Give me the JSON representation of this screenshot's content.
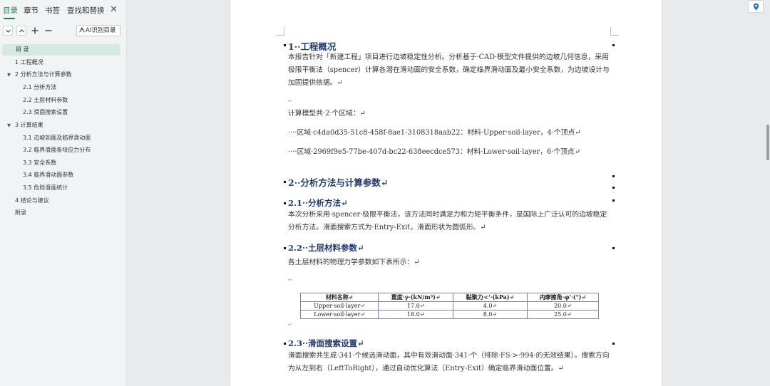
{
  "nav": {
    "tabs": [
      {
        "label": "目录",
        "active": true
      },
      {
        "label": "章节",
        "active": false
      },
      {
        "label": "书签",
        "active": false
      },
      {
        "label": "查找和替换",
        "active": false
      }
    ],
    "close_icon": "close-icon",
    "toolbar": {
      "collapse_icon": "chevron-down-icon",
      "expand_icon": "chevron-up-icon",
      "add_icon": "plus-icon",
      "remove_icon": "minus-icon",
      "ai_label": "AI识别目录",
      "ai_icon": "ai-icon"
    },
    "toc": [
      {
        "label": "目  录",
        "level": 0,
        "selected": true,
        "caret": ""
      },
      {
        "label": "1  工程概况",
        "level": 0,
        "selected": false,
        "caret": ""
      },
      {
        "label": "2  分析方法与计算参数",
        "level": 0,
        "selected": false,
        "caret": "▼"
      },
      {
        "label": "2.1  分析方法",
        "level": 1,
        "selected": false,
        "caret": ""
      },
      {
        "label": "2.2  土层材料参数",
        "level": 1,
        "selected": false,
        "caret": ""
      },
      {
        "label": "2.3  滑面搜索设置",
        "level": 1,
        "selected": false,
        "caret": ""
      },
      {
        "label": "3  计算结果",
        "level": 0,
        "selected": false,
        "caret": "▼"
      },
      {
        "label": "3.1  边坡剖面及临界滑动面",
        "level": 1,
        "selected": false,
        "caret": ""
      },
      {
        "label": "3.2  临界滑面条块应力分布",
        "level": 1,
        "selected": false,
        "caret": ""
      },
      {
        "label": "3.3  安全系数",
        "level": 1,
        "selected": false,
        "caret": ""
      },
      {
        "label": "3.4  临界滑动面参数",
        "level": 1,
        "selected": false,
        "caret": ""
      },
      {
        "label": "3.5  危险滑面统计",
        "level": 1,
        "selected": false,
        "caret": ""
      },
      {
        "label": "4  结论与建议",
        "level": 0,
        "selected": false,
        "caret": ""
      },
      {
        "label": "附录",
        "level": -1,
        "selected": false,
        "caret": ""
      }
    ]
  },
  "doc": {
    "s1_title": "1··工程概况",
    "s1_para": "本报告针对「新建工程」项目进行边坡稳定性分析。分析基于·CAD·模型文件提供的边坡几何信息，采用极限平衡法（spencer）计算各潜在滑动面的安全系数，确定临界滑动面及最小安全系数，为边坡设计与加固提供依据。↵",
    "empty_mark": "↵",
    "model_line": "计算模型共·2·个区域：↵",
    "region1": "····区域·c4da0d35-51c8-458f-8ae1-3108318aab22：材料·Upper·soil·layer，4·个顶点↵",
    "region2": "····区域·2969f9e5-77be-407d-bc22-638eecdce573：材料·Lower·soil·layer，6·个顶点↵",
    "s2_title": "2··分析方法与计算参数↵",
    "s21_title": "2.1··分析方法↵",
    "s21_para": "本次分析采用·spencer·极限平衡法，该方法同时满足力和力矩平衡条件，是国际上广泛认可的边坡稳定分析方法。滑面搜索方式为·Entry-Exit，滑面形状为圆弧形。↵",
    "s22_title": "2.2··土层材料参数↵",
    "s22_para": "各土层材料的物理力学参数如下表所示：↵",
    "table": {
      "headers": [
        "材料名称↵",
        "重度·γ·(kN/m³)↵",
        "黏聚力·c'·(kPa)↵",
        "内摩擦角·φ'·(°)↵"
      ],
      "rows": [
        [
          "Upper·soil·layer↵",
          "17.0↵",
          "4.0↵",
          "20.0↵"
        ],
        [
          "Lower·soil·layer↵",
          "18.0↵",
          "8.0↵",
          "25.0↵"
        ]
      ]
    },
    "s23_title": "2.3··滑面搜索设置↵",
    "s23_para": "滑面搜索共生成·341·个候选滑动面，其中有效滑动面·341·个（排除·FS·>·994·的无效结果）。搜索方向为从左到右（LeftToRight），通过自动优化算法（Entry-Exit）确定临界滑动面位置。↵"
  },
  "right_tools": {
    "location_icon": "location-pin-icon"
  },
  "colors": {
    "accent": "#1f7a4d",
    "heading": "#1f3b6e",
    "selected_bg": "#d5ebdf"
  }
}
